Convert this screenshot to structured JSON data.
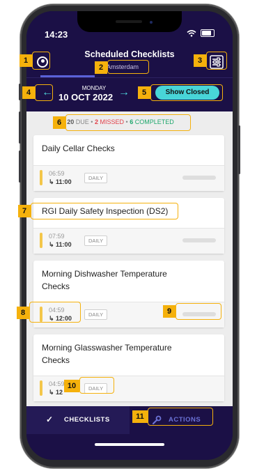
{
  "status_bar": {
    "time": "14:23"
  },
  "header": {
    "title": "Scheduled Checklists",
    "location": "Amsterdam"
  },
  "date_bar": {
    "day": "MONDAY",
    "date": "10 OCT 2022",
    "show_closed_label": "Show Closed"
  },
  "summary": {
    "due_count": "20",
    "due_label": "DUE",
    "missed_count": "2",
    "missed_label": "MISSED",
    "completed_count": "6",
    "completed_label": "COMPLETED",
    "separator": "•"
  },
  "cards": [
    {
      "title": "Daily Cellar Checks",
      "start": "06:59",
      "end": "11:00",
      "frequency": "DAILY"
    },
    {
      "title": "RGI Daily Safety Inspection (DS2)",
      "start": "07:59",
      "end": "11:00",
      "frequency": "DAILY"
    },
    {
      "title": "Morning Dishwasher Temperature Checks",
      "start": "04:59",
      "end": "12:00",
      "frequency": "DAILY"
    },
    {
      "title": "Morning Glasswasher Temperature Checks",
      "start": "04:59",
      "end": "12",
      "frequency": "DAILY"
    }
  ],
  "bottom_nav": {
    "checklists_label": "CHECKLISTS",
    "actions_label": "ACTIONS"
  },
  "callouts": [
    "1",
    "2",
    "3",
    "4",
    "5",
    "6",
    "7",
    "8",
    "9",
    "10",
    "11"
  ],
  "colors": {
    "accent_teal": "#48d5d8",
    "brand_purple": "#1b1046",
    "callout_yellow": "#f5b10c",
    "missed_red": "#e2414a",
    "completed_green": "#20a86e"
  },
  "icons": {
    "profile": "user-circle-icon",
    "filter": "sliders-icon",
    "prev": "arrow-left-icon",
    "next": "arrow-right-icon",
    "checklists": "checkmark-icon",
    "actions": "wrench-icon"
  }
}
